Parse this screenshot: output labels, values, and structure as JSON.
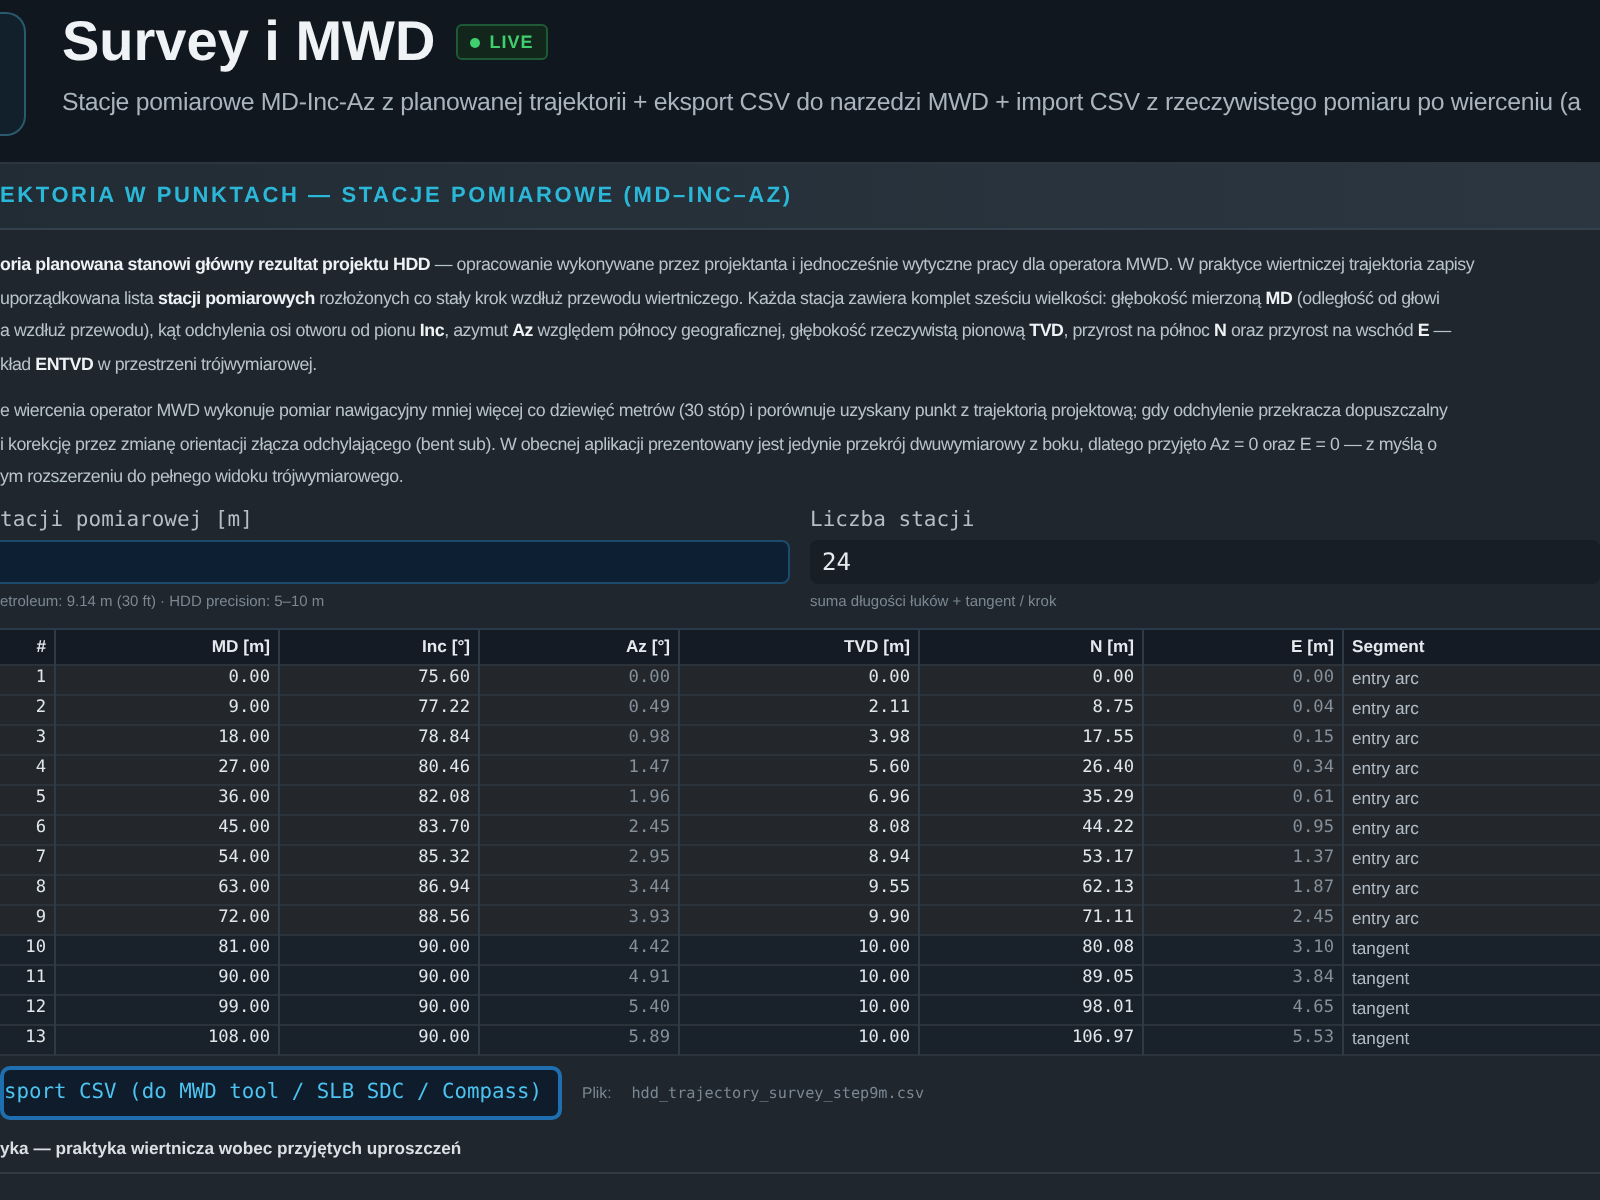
{
  "header": {
    "title": "Survey i MWD",
    "badge": "LIVE",
    "subtitle": "Stacje pomiarowe MD-Inc-Az z planowanej trajektorii + eksport CSV do narzedzi MWD + import CSV z rzeczywistego pomiaru po wierceniu (a"
  },
  "panel": {
    "title": "EKTORIA W PUNKTACH — STACJE POMIAROWE (MD–INC–AZ)",
    "paragraphs": [
      [
        "**oria planowana stanowi główny rezultat projektu HDD** — opracowanie wykonywane przez projektanta i jednocześnie wytyczne pracy dla operatora MWD. W praktyce wiertniczej trajektoria zapisy",
        "uporządkowana lista **stacji pomiarowych** rozłożonych co stały krok wzdłuż przewodu wiertniczego. Każda stacja zawiera komplet sześciu wielkości: głębokość mierzoną **MD** (odległość od głowi",
        "a wzdłuż przewodu), kąt odchylenia osi otworu od pionu **Inc**, azymut **Az** względem północy geograficznej, głębokość rzeczywistą pionową **TVD**, przyrost na północ **N** oraz przyrost na wschód **E** —",
        "kład **ENTVD** w przestrzeni trójwymiarowej."
      ],
      [
        "e wiercenia operator MWD wykonuje pomiar nawigacyjny mniej więcej co dziewięć metrów (30 stóp) i porównuje uzyskany punkt z trajektorią projektową; gdy odchylenie przekracza dopuszczalny",
        "i korekcję przez zmianę orientacji złącza odchylającego (bent sub). W obecnej aplikacji prezentowany jest jedynie przekrój dwuwymiarowy z boku, dlatego przyjęto Az = 0 oraz E = 0 — z myślą o",
        "ym rozszerzeniu do pełnego widoku trójwymiarowego."
      ]
    ],
    "fields": [
      {
        "label": "tacji pomiarowej [m]",
        "focused": true,
        "hint": "etroleum: 9.14 m (30 ft) · HDD precision: 5–10 m"
      },
      {
        "label": "Liczba stacji",
        "focused": false,
        "value": "24",
        "hint": "suma długości łuków + tangent / krok"
      }
    ],
    "table": {
      "columns": [
        {
          "label": "#",
          "muted": false
        },
        {
          "label": "MD [m]",
          "muted": false
        },
        {
          "label": "Inc [°]",
          "muted": false
        },
        {
          "label": "Az [°]",
          "muted": true
        },
        {
          "label": "TVD [m]",
          "muted": false
        },
        {
          "label": "N [m]",
          "muted": false
        },
        {
          "label": "E [m]",
          "muted": true
        },
        {
          "label": "Segment",
          "muted": false
        }
      ],
      "rows": [
        {
          "kind": "arc",
          "cells": [
            "1",
            "0.00",
            "75.60",
            "0.00",
            "0.00",
            "0.00",
            "0.00",
            "entry arc"
          ]
        },
        {
          "kind": "arc",
          "cells": [
            "2",
            "9.00",
            "77.22",
            "0.49",
            "2.11",
            "8.75",
            "0.04",
            "entry arc"
          ]
        },
        {
          "kind": "arc",
          "cells": [
            "3",
            "18.00",
            "78.84",
            "0.98",
            "3.98",
            "17.55",
            "0.15",
            "entry arc"
          ]
        },
        {
          "kind": "arc",
          "cells": [
            "4",
            "27.00",
            "80.46",
            "1.47",
            "5.60",
            "26.40",
            "0.34",
            "entry arc"
          ]
        },
        {
          "kind": "arc",
          "cells": [
            "5",
            "36.00",
            "82.08",
            "1.96",
            "6.96",
            "35.29",
            "0.61",
            "entry arc"
          ]
        },
        {
          "kind": "arc",
          "cells": [
            "6",
            "45.00",
            "83.70",
            "2.45",
            "8.08",
            "44.22",
            "0.95",
            "entry arc"
          ]
        },
        {
          "kind": "arc",
          "cells": [
            "7",
            "54.00",
            "85.32",
            "2.95",
            "8.94",
            "53.17",
            "1.37",
            "entry arc"
          ]
        },
        {
          "kind": "arc",
          "cells": [
            "8",
            "63.00",
            "86.94",
            "3.44",
            "9.55",
            "62.13",
            "1.87",
            "entry arc"
          ]
        },
        {
          "kind": "arc",
          "cells": [
            "9",
            "72.00",
            "88.56",
            "3.93",
            "9.90",
            "71.11",
            "2.45",
            "entry arc"
          ]
        },
        {
          "kind": "tangent",
          "cells": [
            "10",
            "81.00",
            "90.00",
            "4.42",
            "10.00",
            "80.08",
            "3.10",
            "tangent"
          ]
        },
        {
          "kind": "tangent",
          "cells": [
            "11",
            "90.00",
            "90.00",
            "4.91",
            "10.00",
            "89.05",
            "3.84",
            "tangent"
          ]
        },
        {
          "kind": "tangent",
          "cells": [
            "12",
            "99.00",
            "90.00",
            "5.40",
            "10.00",
            "98.01",
            "4.65",
            "tangent"
          ]
        },
        {
          "kind": "tangent",
          "cells": [
            "13",
            "108.00",
            "90.00",
            "5.89",
            "10.00",
            "106.97",
            "5.53",
            "tangent"
          ]
        }
      ]
    },
    "export": {
      "button": "sport CSV (do MWD tool / SLB SDC / Compass)",
      "file_label": "Plik:",
      "file_name": "hdd_trajectory_survey_step9m.csv"
    },
    "footer_heading": "yka — praktyka wiertnicza wobec przyjętych uproszczeń"
  }
}
